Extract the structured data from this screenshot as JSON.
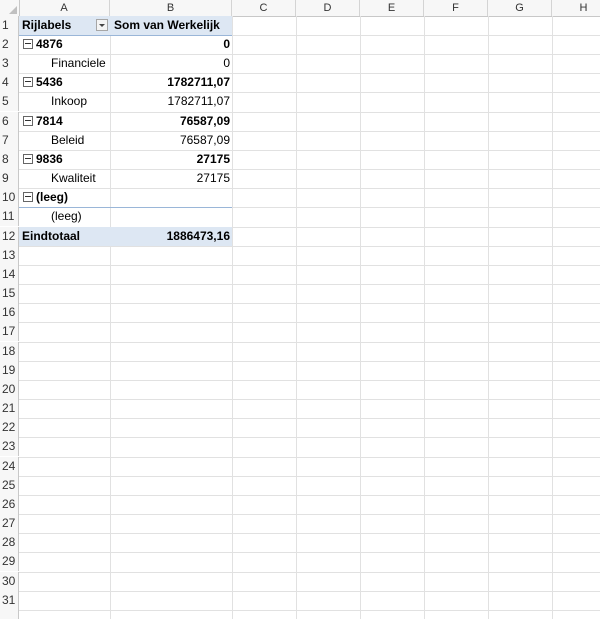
{
  "columns": [
    "A",
    "B",
    "C",
    "D",
    "E",
    "F",
    "G",
    "H"
  ],
  "row_numbers": [
    "1",
    "2",
    "3",
    "4",
    "5",
    "6",
    "7",
    "8",
    "9",
    "10",
    "11",
    "12",
    "13",
    "14",
    "15",
    "16",
    "17",
    "18",
    "19",
    "20",
    "21",
    "22",
    "23",
    "24",
    "25",
    "26",
    "27",
    "28",
    "29",
    "30",
    "31"
  ],
  "pivot": {
    "header": {
      "row_labels": "Rijlabels",
      "value_header": "Som van Werkelijk"
    },
    "rows": [
      {
        "label": "4876",
        "value": "0"
      },
      {
        "label": "Financiele",
        "value": "0"
      },
      {
        "label": "5436",
        "value": "1782711,07"
      },
      {
        "label": "Inkoop",
        "value": "1782711,07"
      },
      {
        "label": "7814",
        "value": "76587,09"
      },
      {
        "label": "Beleid",
        "value": "76587,09"
      },
      {
        "label": "9836",
        "value": "27175"
      },
      {
        "label": "Kwaliteit",
        "value": "27175"
      },
      {
        "label": "(leeg)",
        "value": ""
      },
      {
        "label": "(leeg)",
        "value": ""
      }
    ],
    "total": {
      "label": "Eindtotaal",
      "value": "1886473,16"
    }
  },
  "icons": {
    "filter": "dropdown-filter-icon",
    "collapse": "collapse-minus-icon",
    "select_all": "select-all-corner-icon"
  }
}
